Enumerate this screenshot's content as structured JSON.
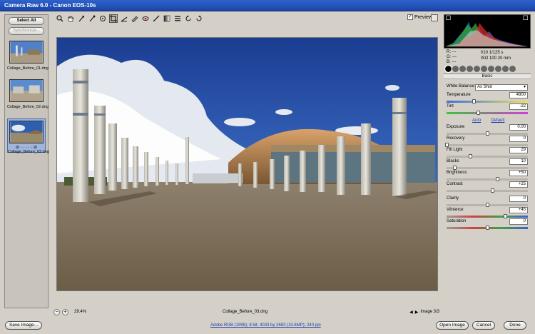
{
  "window": {
    "title": "Camera Raw 6.0  -  Canon EOS-10s"
  },
  "toolbar": {
    "tools": [
      "zoom-icon",
      "hand-icon",
      "white-balance-icon",
      "color-sampler-icon",
      "targeted-adjust-icon",
      "crop-icon",
      "straighten-icon",
      "spot-removal-icon",
      "red-eye-icon",
      "adjustment-brush-icon",
      "graduated-filter-icon",
      "preferences-icon",
      "rotate-ccw-icon",
      "rotate-cw-icon"
    ],
    "preview_label": "Preview",
    "preview_checked": true
  },
  "filmstrip": {
    "select_all": "Select All",
    "synchronize": "Synchronize...",
    "items": [
      {
        "name": "Collage_Before_01.dng"
      },
      {
        "name": "Collage_Before_02.dng"
      },
      {
        "name": "Collage_Before_03.dng"
      }
    ]
  },
  "status": {
    "zoom": "29.4%",
    "filename": "Collage_Before_03.dng",
    "image_counter": "Image 3/3"
  },
  "readout": {
    "r": "R:  ---",
    "g": "G:  ---",
    "b": "B:  ---",
    "aperture_shutter": "f/10   1/125 s",
    "iso_focal": "ISO 100   20 mm"
  },
  "panel": {
    "title": "Basic",
    "white_balance_label": "White Balance:",
    "white_balance_value": "As Shot",
    "auto": "Auto",
    "default": "Default",
    "sliders": [
      {
        "label": "Temperature",
        "value": "4800",
        "pos": 0.33
      },
      {
        "label": "Tint",
        "value": "-22",
        "pos": 0.39
      },
      {
        "label": "Exposure",
        "value": "0.00",
        "pos": 0.5
      },
      {
        "label": "Recovery",
        "value": "0",
        "pos": 0.0
      },
      {
        "label": "Fill Light",
        "value": "29",
        "pos": 0.29
      },
      {
        "label": "Blacks",
        "value": "10",
        "pos": 0.1
      },
      {
        "label": "Brightness",
        "value": "+50",
        "pos": 0.62
      },
      {
        "label": "Contrast",
        "value": "+25",
        "pos": 0.56
      },
      {
        "label": "Clarity",
        "value": "0",
        "pos": 0.5
      },
      {
        "label": "Vibrance",
        "value": "+45",
        "pos": 0.72
      },
      {
        "label": "Saturation",
        "value": "0",
        "pos": 0.5
      }
    ]
  },
  "footer": {
    "save_image": "Save Image...",
    "workflow": "Adobe RGB (1998); 8 bit; 4033 by 2683 (10.8MP); 240 ppi",
    "open_image": "Open Image",
    "cancel": "Cancel",
    "done": "Done"
  },
  "colors": {
    "title_bar": "#2f62cc",
    "selection": "#9fb5d9",
    "link": "#1a3eb0"
  }
}
